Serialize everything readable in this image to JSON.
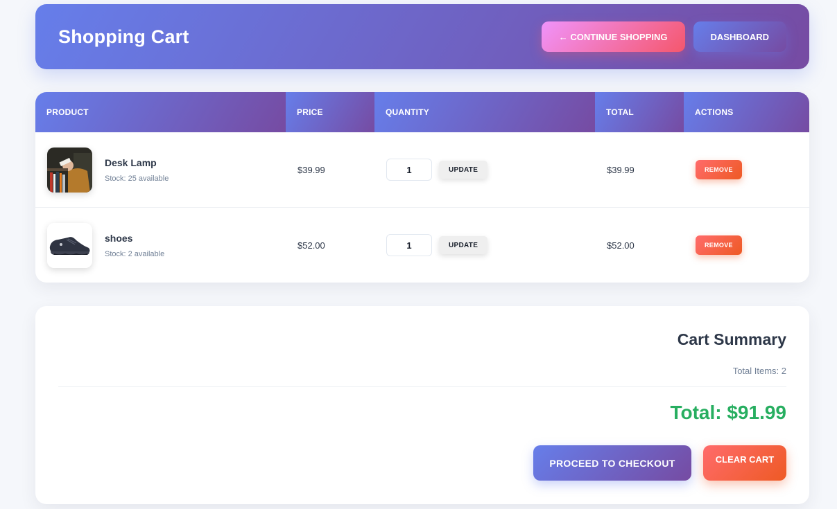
{
  "header": {
    "title": "Shopping Cart",
    "continue_label": "← CONTINUE SHOPPING",
    "dashboard_label": "DASHBOARD"
  },
  "table": {
    "columns": [
      "PRODUCT",
      "PRICE",
      "QUANTITY",
      "TOTAL",
      "ACTIONS"
    ],
    "rows": [
      {
        "name": "Desk Lamp",
        "stock": "Stock: 25 available",
        "price": "$39.99",
        "quantity": "1",
        "update_label": "UPDATE",
        "total": "$39.99",
        "remove_label": "REMOVE",
        "image_icon": "desk-lamp-photo"
      },
      {
        "name": "shoes",
        "stock": "Stock: 2 available",
        "price": "$52.00",
        "quantity": "1",
        "update_label": "UPDATE",
        "total": "$52.00",
        "remove_label": "REMOVE",
        "image_icon": "shoe-photo"
      }
    ]
  },
  "summary": {
    "title": "Cart Summary",
    "total_items": "Total Items: 2",
    "total": "Total: $91.99",
    "checkout_label": "PROCEED TO CHECKOUT",
    "clear_label": "CLEAR CART"
  },
  "colors": {
    "primary_gradient_start": "#667eea",
    "primary_gradient_end": "#764ba2",
    "danger_start": "#ff6b6b",
    "danger_end": "#ee5a24",
    "total_green": "#27ae60"
  }
}
